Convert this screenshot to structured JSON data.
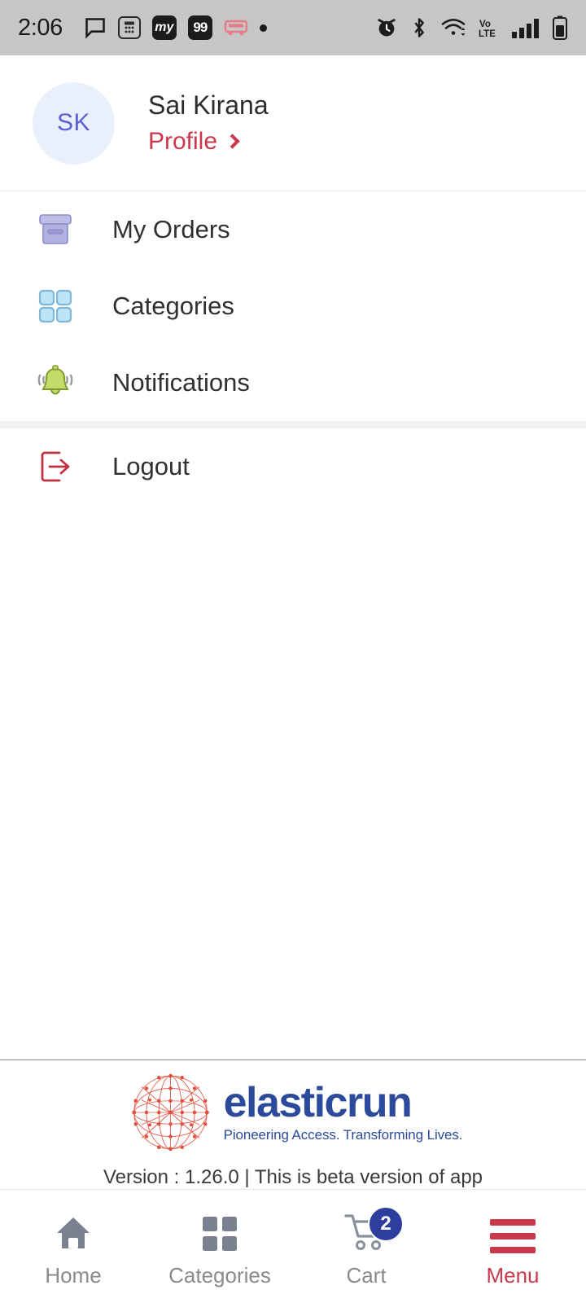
{
  "statusbar": {
    "time": "2:06",
    "left_icons": [
      {
        "name": "chat-bubble-icon",
        "label": ""
      },
      {
        "name": "calculator-icon",
        "label": ""
      },
      {
        "name": "my-app-badge-icon",
        "label": "my"
      },
      {
        "name": "notification-count-badge-icon",
        "label": "99"
      },
      {
        "name": "redbus-app-icon",
        "label": ""
      },
      {
        "name": "more-notifications-dot-icon",
        "label": ""
      }
    ],
    "right_icons": [
      {
        "name": "alarm-clock-icon",
        "label": ""
      },
      {
        "name": "bluetooth-icon",
        "label": ""
      },
      {
        "name": "wifi-icon",
        "label": ""
      },
      {
        "name": "volte-icon",
        "label": "VoLTE"
      },
      {
        "name": "cellular-signal-icon",
        "label": ""
      },
      {
        "name": "battery-icon",
        "label": ""
      }
    ]
  },
  "profile": {
    "initials": "SK",
    "name": "Sai Kirana",
    "link_label": "Profile"
  },
  "menu": {
    "items": [
      {
        "label": "My Orders",
        "icon": "archive-box-icon"
      },
      {
        "label": "Categories",
        "icon": "grid-squares-icon"
      },
      {
        "label": "Notifications",
        "icon": "bell-icon"
      },
      {
        "label": "Logout",
        "icon": "logout-arrow-icon"
      }
    ]
  },
  "footer": {
    "brand_name": "elasticrun",
    "brand_tagline": "Pioneering Access. Transforming Lives.",
    "version_text": "Version : 1.26.0 | This is beta version of app"
  },
  "bottom_nav": {
    "items": [
      {
        "label": "Home",
        "icon": "home-icon",
        "active": false,
        "badge": ""
      },
      {
        "label": "Categories",
        "icon": "grid-squares-icon",
        "active": false,
        "badge": ""
      },
      {
        "label": "Cart",
        "icon": "shopping-cart-icon",
        "active": false,
        "badge": "2"
      },
      {
        "label": "Menu",
        "icon": "hamburger-menu-icon",
        "active": true,
        "badge": ""
      }
    ]
  },
  "colors": {
    "accent_red": "#c9384b",
    "brand_blue": "#2b4a9b",
    "badge_blue": "#2e3e9e",
    "avatar_bg": "#e9f0fc",
    "avatar_text": "#5b5fd6",
    "statusbar_bg": "#c6c6c6",
    "inactive_gray": "#8a8a8a"
  }
}
